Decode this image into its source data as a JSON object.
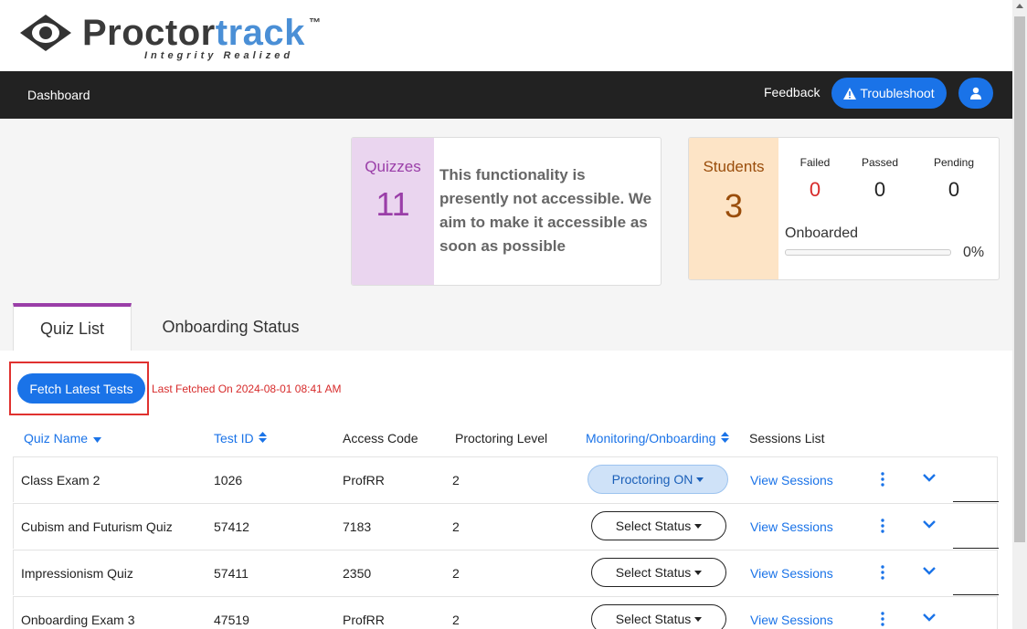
{
  "brand": {
    "name_part1": "Proctor",
    "name_part2": "track",
    "tm": "™",
    "tagline": "Integrity Realized"
  },
  "nav": {
    "dashboard": "Dashboard",
    "feedback": "Feedback",
    "troubleshoot": "Troubleshoot",
    "troubleshoot_icon": "warning-icon",
    "user_icon": "user-icon"
  },
  "quizzes_card": {
    "label": "Quizzes",
    "count": "11",
    "message": "This functionality is presently not accessible. We aim to make it accessible as soon as possible"
  },
  "students_card": {
    "label": "Students",
    "count": "3",
    "failed_label": "Failed",
    "failed_value": "0",
    "passed_label": "Passed",
    "passed_value": "0",
    "pending_label": "Pending",
    "pending_value": "0",
    "onboarded_label": "Onboarded",
    "onboarded_percent": "0%",
    "onboarded_fraction": 0
  },
  "tabs": {
    "quiz_list": "Quiz List",
    "onboarding_status": "Onboarding Status"
  },
  "toolbar": {
    "fetch_button": "Fetch Latest Tests",
    "last_fetched": "Last Fetched On 2024-08-01 08:41 AM"
  },
  "table": {
    "headers": {
      "quiz_name": "Quiz Name",
      "test_id": "Test ID",
      "access_code": "Access Code",
      "proctoring_level": "Proctoring Level",
      "monitoring": "Monitoring/Onboarding",
      "sessions_list": "Sessions List"
    },
    "rows": [
      {
        "name": "Class Exam 2",
        "test_id": "1026",
        "access_code": "ProfRR",
        "level": "2",
        "status": "Proctoring ON",
        "status_active": true,
        "sessions": "View Sessions"
      },
      {
        "name": "Cubism and Futurism Quiz",
        "test_id": "57412",
        "access_code": "7183",
        "level": "2",
        "status": "Select Status",
        "status_active": false,
        "sessions": "View Sessions"
      },
      {
        "name": "Impressionism Quiz",
        "test_id": "57411",
        "access_code": "2350",
        "level": "2",
        "status": "Select Status",
        "status_active": false,
        "sessions": "View Sessions"
      },
      {
        "name": "Onboarding Exam 3",
        "test_id": "47519",
        "access_code": "ProfRR",
        "level": "2",
        "status": "Select Status",
        "status_active": false,
        "sessions": "View Sessions"
      }
    ]
  },
  "colors": {
    "accent_blue": "#1a73e8",
    "quiz_purple": "#9a3ea8",
    "student_brown": "#9a4d0b",
    "failed_red": "#d72b2b",
    "highlight_red": "#e0312f"
  }
}
